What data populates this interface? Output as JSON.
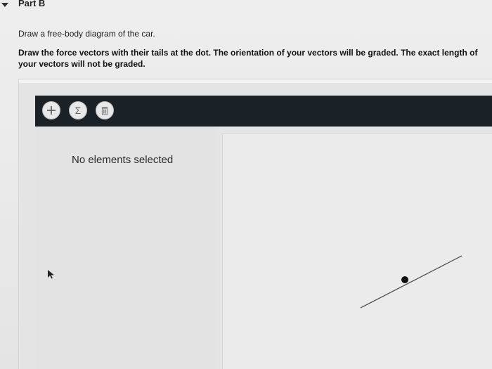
{
  "header": {
    "title": "Part B"
  },
  "question": {
    "prompt": "Draw a free-body diagram of the car.",
    "instructions": "Draw the force vectors with their tails at the dot. The orientation of your vectors will be graded. The exact length of your vectors will not be graded."
  },
  "toolbar": {
    "buttons": [
      {
        "icon": "plus-icon",
        "label": "+"
      },
      {
        "icon": "sigma-icon",
        "label": "Σ"
      },
      {
        "icon": "trash-icon",
        "label": ""
      }
    ]
  },
  "panel": {
    "status": "No elements selected"
  },
  "colors": {
    "toolbar": "#1a2228",
    "background": "#e9e9e9"
  }
}
